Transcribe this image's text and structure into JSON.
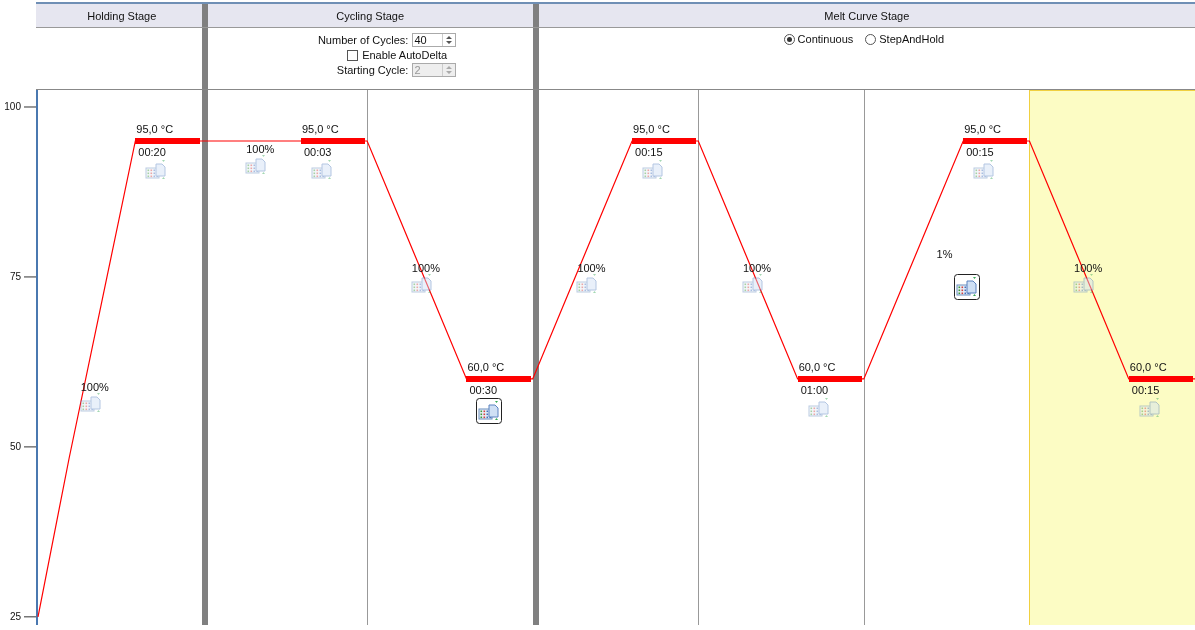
{
  "stages": [
    {
      "title": "Holding Stage",
      "kind": "holding",
      "steps": [
        {
          "ramp": "100%",
          "ramp_collect": false,
          "temperature": "95,0 °C",
          "time": "00:20",
          "hold_collect": false,
          "selected": false
        }
      ]
    },
    {
      "title": "Cycling Stage",
      "kind": "cycling",
      "cycles": {
        "label": "Number of Cycles:",
        "value": "40"
      },
      "auto_delta": {
        "label": "Enable AutoDelta",
        "checked": false
      },
      "starting_cycle": {
        "label": "Starting Cycle:",
        "value": "2",
        "disabled": true
      },
      "steps": [
        {
          "ramp": "100%",
          "ramp_collect": false,
          "temperature": "95,0 °C",
          "time": "00:03",
          "hold_collect": false,
          "selected": false
        },
        {
          "ramp": "100%",
          "ramp_collect": false,
          "temperature": "60,0 °C",
          "time": "00:30",
          "hold_collect": true,
          "selected": false
        }
      ]
    },
    {
      "title": "Melt Curve Stage",
      "kind": "melt",
      "modes": [
        {
          "label": "Continuous",
          "selected": true
        },
        {
          "label": "StepAndHold",
          "selected": false
        }
      ],
      "steps": [
        {
          "ramp": "100%",
          "ramp_collect": false,
          "temperature": "95,0 °C",
          "time": "00:15",
          "hold_collect": false,
          "selected": false
        },
        {
          "ramp": "100%",
          "ramp_collect": false,
          "temperature": "60,0 °C",
          "time": "01:00",
          "hold_collect": false,
          "selected": false
        },
        {
          "ramp": "1%",
          "ramp_collect": true,
          "temperature": "95,0 °C",
          "time": "00:15",
          "hold_collect": false,
          "selected": false
        },
        {
          "ramp": "100%",
          "ramp_collect": false,
          "temperature": "60,0 °C",
          "time": "00:15",
          "hold_collect": false,
          "selected": true
        }
      ]
    }
  ],
  "profile": {
    "chart_data": {
      "type": "line",
      "ylim": [
        23.8,
        102.5
      ],
      "yticks": [
        25,
        50,
        75,
        100
      ],
      "series": [
        {
          "color": "#ff0000",
          "values": [
            25,
            48.33,
            71.67,
            95,
            95,
            95,
            95,
            95,
            95,
            95,
            95,
            83.33,
            71.67,
            60,
            60,
            60,
            71.67,
            83.33,
            95,
            95,
            95,
            83.33,
            71.67,
            60,
            60,
            60,
            71.67,
            83.33,
            95,
            95,
            95,
            83.33,
            71.67,
            60,
            60,
            60
          ]
        }
      ]
    }
  }
}
